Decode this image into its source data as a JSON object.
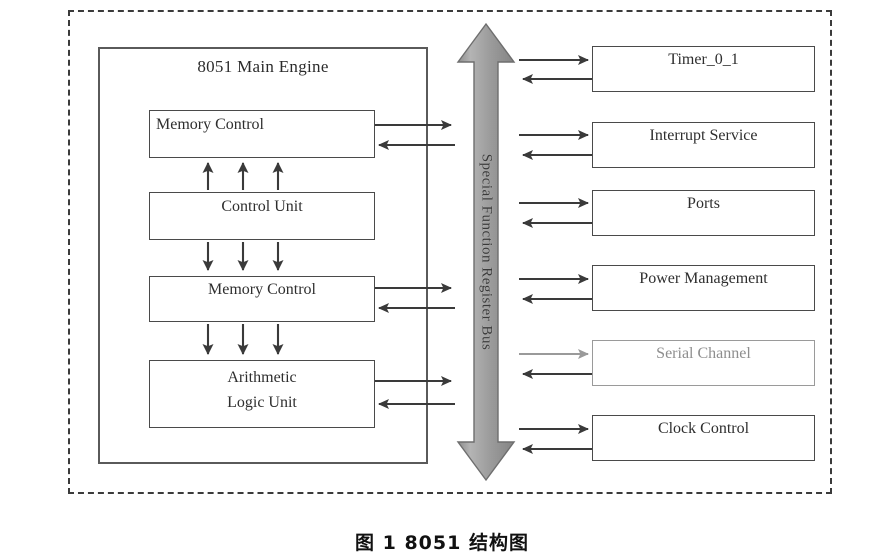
{
  "figure": {
    "caption": "图 1   8051 结构图",
    "engine_title": "8051 Main Engine"
  },
  "engine_units": [
    {
      "id": "unit-mem-1",
      "label": "Memory Control"
    },
    {
      "id": "unit-ctrl",
      "label": "Control Unit"
    },
    {
      "id": "unit-mem-2",
      "label": "Memory Control"
    },
    {
      "id": "unit-alu",
      "label_line1": "Arithmetic",
      "label_line2": "Logic Unit"
    }
  ],
  "bus": {
    "label": "Special Function Register Bus",
    "fill_color": "#9c9c9c",
    "stroke_color": "#6e6e6e"
  },
  "peripherals": [
    {
      "id": "unit-timer",
      "label": "Timer_0_1"
    },
    {
      "id": "unit-int",
      "label": "Interrupt Service"
    },
    {
      "id": "unit-ports",
      "label": "Ports"
    },
    {
      "id": "unit-power",
      "label": "Power Management"
    },
    {
      "id": "unit-serial",
      "label": "Serial Channel"
    },
    {
      "id": "unit-clock",
      "label": "Clock Control"
    }
  ],
  "colors": {
    "line": "#3a3a3a",
    "box_border": "#4a4a4a",
    "dashed_border": "#3b3b3b",
    "faded_text": "#8e8e8e"
  }
}
